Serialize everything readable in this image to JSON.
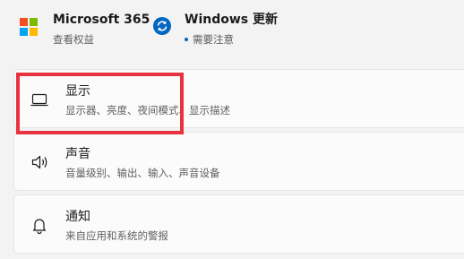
{
  "top": {
    "microsoft365": {
      "title": "Microsoft 365",
      "subtitle": "查看权益",
      "icon": "microsoft-logo-icon"
    },
    "windows_update": {
      "title": "Windows 更新",
      "subtitle": "需要注意",
      "icon": "sync-icon"
    }
  },
  "settings": [
    {
      "label": "显示",
      "description": "显示器、亮度、夜间模式、显示描述",
      "icon": "monitor-icon"
    },
    {
      "label": "声音",
      "description": "音量级别、输出、输入、声音设备",
      "icon": "speaker-icon"
    },
    {
      "label": "通知",
      "description": "来自应用和系统的警报",
      "icon": "bell-icon"
    }
  ],
  "colors": {
    "accent": "#0067c0",
    "highlight": "#e8323f",
    "ms_red": "#f25022",
    "ms_green": "#7fba00",
    "ms_blue": "#00a4ef",
    "ms_yellow": "#ffb900"
  }
}
